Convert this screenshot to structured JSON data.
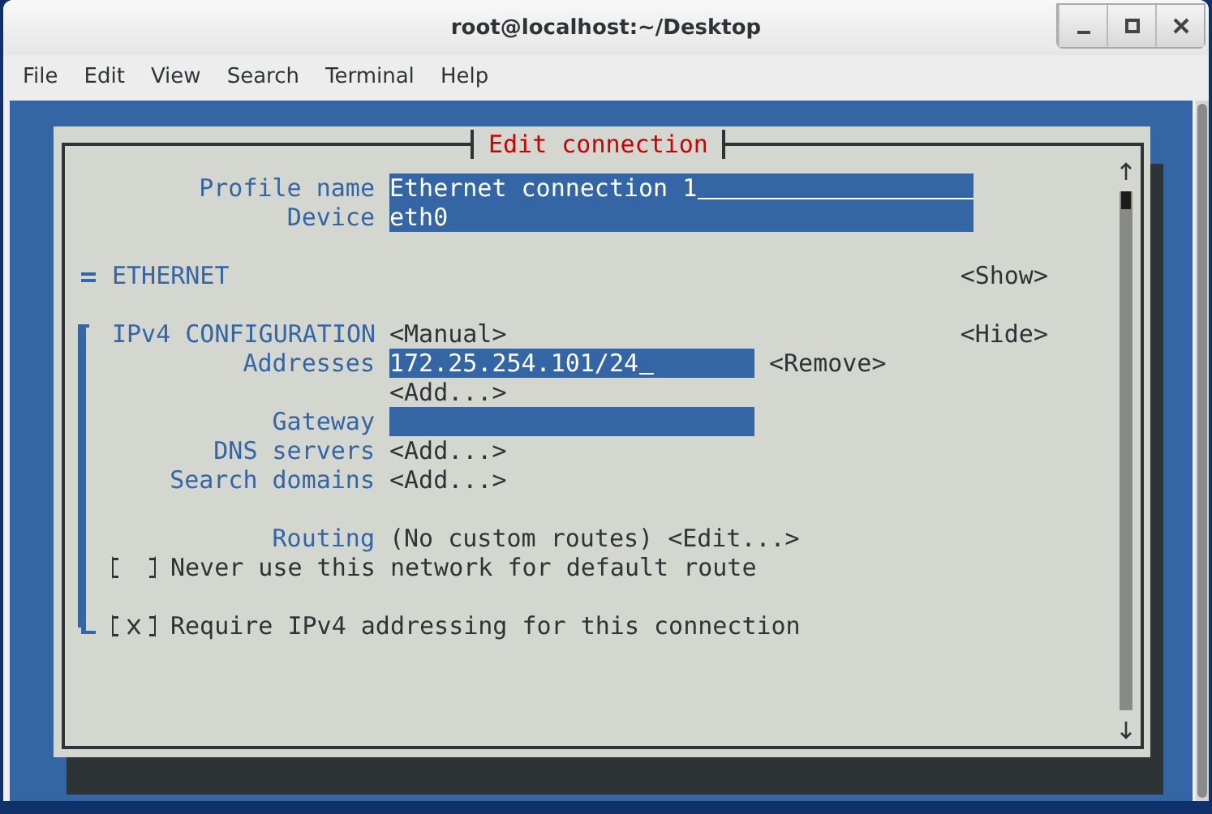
{
  "window": {
    "title": "root@localhost:~/Desktop"
  },
  "menu": [
    "File",
    "Edit",
    "View",
    "Search",
    "Terminal",
    "Help"
  ],
  "dialog": {
    "title": "Edit connection",
    "fields": [
      {
        "label": "Profile name",
        "value": "Ethernet connection 1"
      },
      {
        "label": "Device",
        "value": "eth0"
      }
    ],
    "ethernet": {
      "title": "ETHERNET",
      "expanded": false,
      "toggle": "<Show>"
    },
    "ipv4": {
      "title": "IPv4 CONFIGURATION",
      "expanded": true,
      "mode": "<Manual>",
      "toggle": "<Hide>",
      "addresses": {
        "label": "Addresses",
        "value": "172.25.254.101/24",
        "remove": "<Remove>",
        "add": "<Add...>"
      },
      "gateway": {
        "label": "Gateway"
      },
      "dns": {
        "label": "DNS servers",
        "add": "<Add...>"
      },
      "search": {
        "label": "Search domains",
        "add": "<Add...>"
      },
      "routing": {
        "label": "Routing",
        "status": "(No custom routes)",
        "edit": "<Edit...>"
      },
      "checkboxes": [
        {
          "label": "Never use this network for default route",
          "checked": false
        },
        {
          "label": "Require IPv4 addressing for this connection",
          "checked": true
        }
      ]
    }
  }
}
